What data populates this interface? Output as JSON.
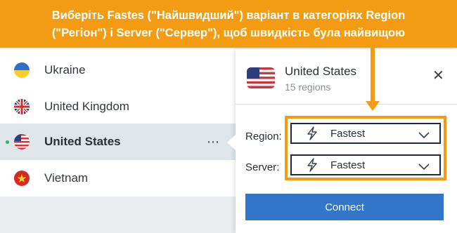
{
  "annotation": {
    "line1": "Виберіть Fastes (\"Найшвидший\") варіант в категоріях Region",
    "line2": "(\"Регіон\") і Server (\"Сервер\"), щоб швидкість була найвищою"
  },
  "countries": [
    {
      "name": "Ukraine",
      "flag": "ukraine-flag"
    },
    {
      "name": "United Kingdom",
      "flag": "uk-flag"
    },
    {
      "name": "United States",
      "flag": "us-flag",
      "selected": true
    },
    {
      "name": "Vietnam",
      "flag": "vietnam-flag"
    }
  ],
  "more_label": "⋯",
  "panel": {
    "title": "United States",
    "subtitle": "15 regions",
    "close": "✕",
    "region_label": "Region:",
    "region_value": "Fastest",
    "server_label": "Server:",
    "server_value": "Fastest",
    "connect_label": "Connect"
  },
  "colors": {
    "accent_orange": "#f29b13",
    "connect_blue": "#3176c9",
    "active_dot": "#37b35a"
  }
}
